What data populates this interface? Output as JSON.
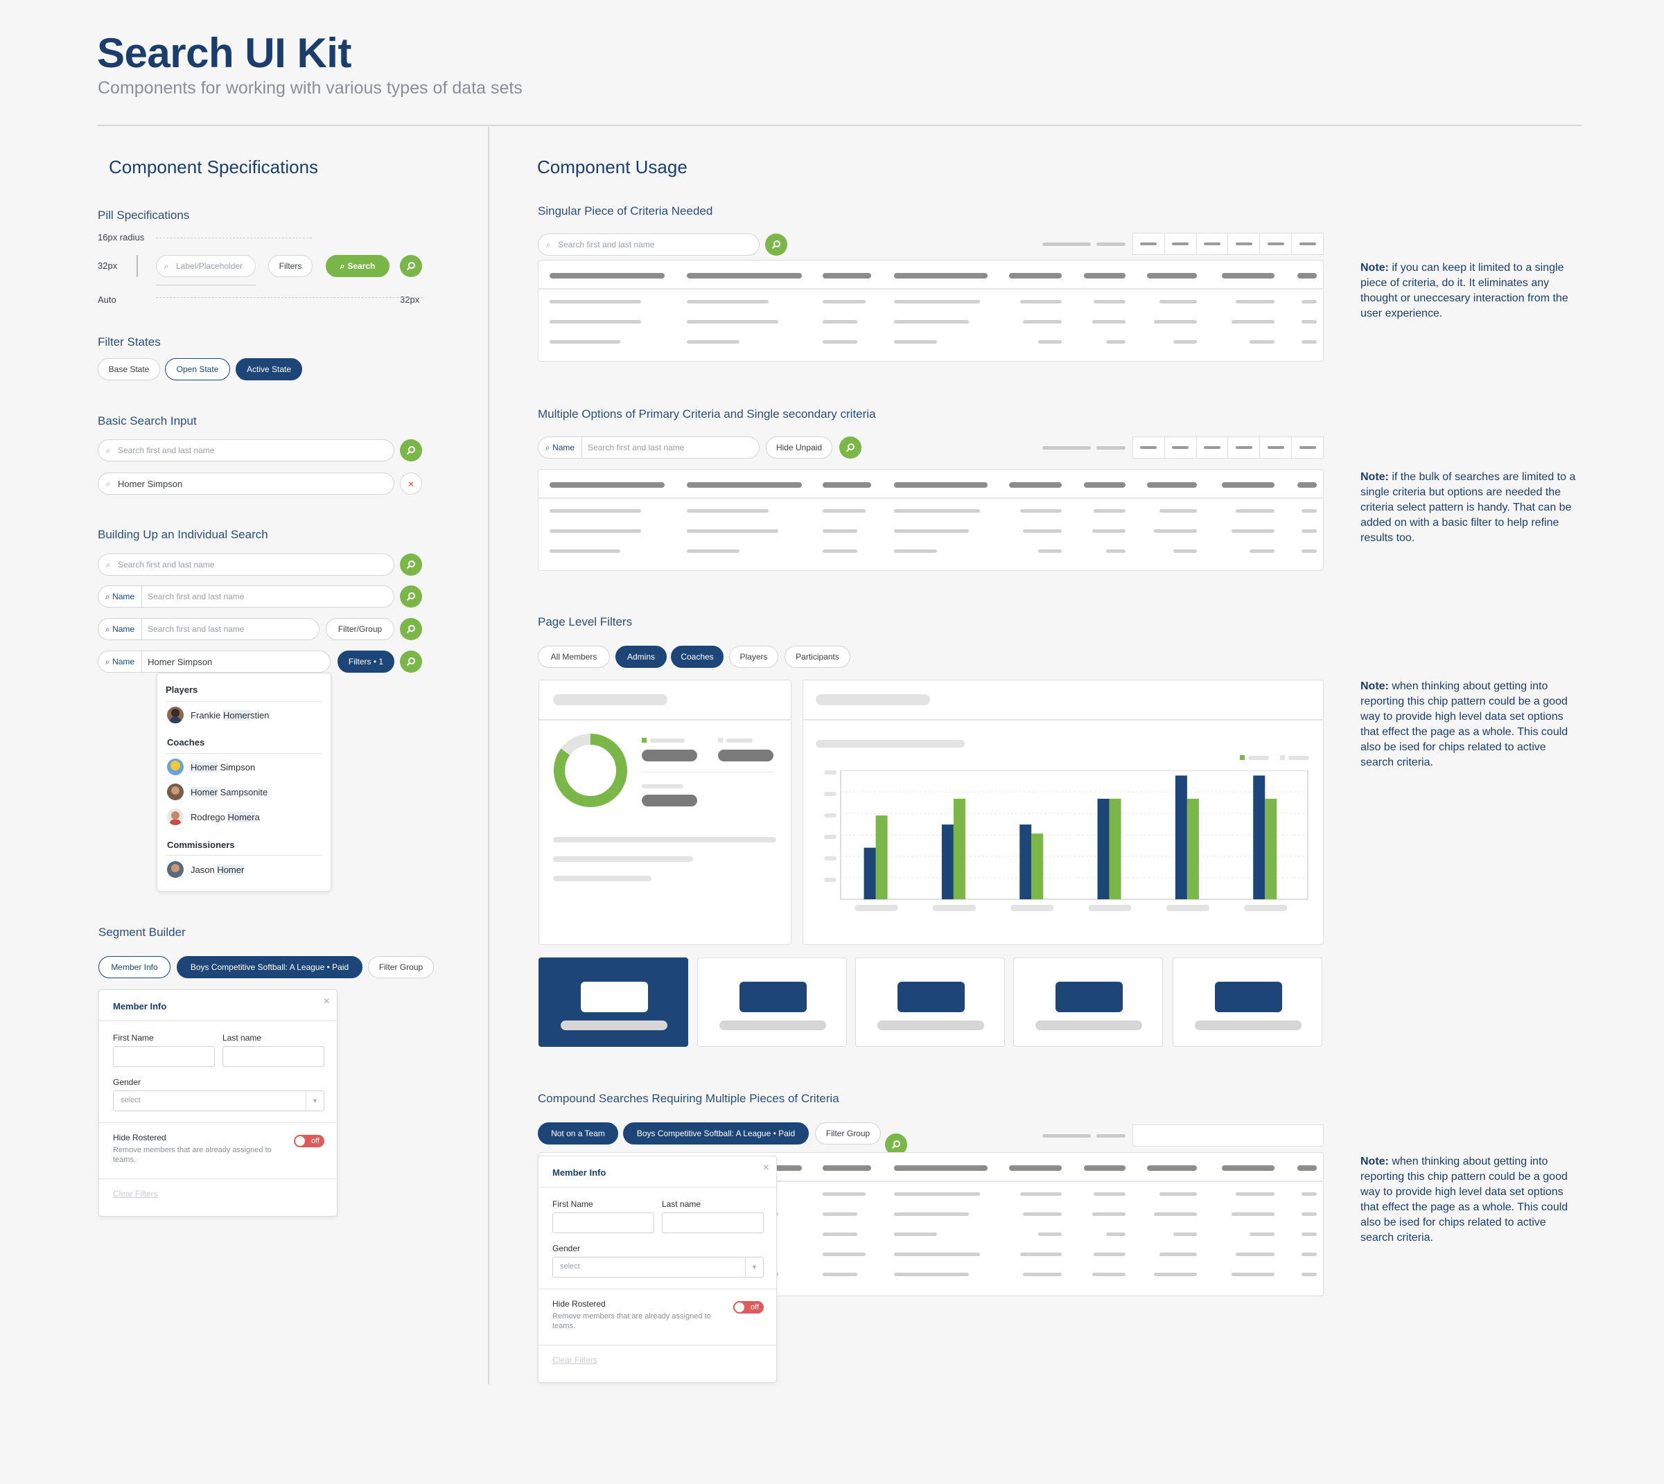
{
  "header": {
    "title": "Search UI Kit",
    "subtitle": "Components for working with various types of data sets"
  },
  "specs": {
    "heading": "Component Specifications",
    "pill_specs": {
      "title": "Pill Specifications",
      "radius_label": "16px radius",
      "height_label": "32px",
      "auto_label": "Auto",
      "width_label": "32px",
      "placeholder": "Label/Placeholder",
      "filters": "Filters",
      "search": "Search"
    },
    "filter_states": {
      "title": "Filter States",
      "base": "Base State",
      "open": "Open State",
      "active": "Active State"
    },
    "basic_search": {
      "title": "Basic Search Input",
      "placeholder": "Search first and last name",
      "value": "Homer Simpson"
    },
    "building": {
      "title": "Building Up an Individual Search",
      "placeholder": "Search first and last name",
      "name_label": "Name",
      "filter_group": "Filter/Group",
      "value": "Homer Simpson",
      "filters_badge": "Filters • 1"
    },
    "dropdown": {
      "players_heading": "Players",
      "player1_pre": "Frankie ",
      "player1_hl": "Homer",
      "player1_post": "stien",
      "coaches_heading": "Coaches",
      "coach1_hl": "Homer",
      "coach1_post": " Simpson",
      "coach2_hl": "Homer",
      "coach2_post": " Sampsonite",
      "coach3_pre": "Rodrego ",
      "coach3_hl": "Homer",
      "coach3_post": "a",
      "commissioners_heading": "Commissioners",
      "comm1_pre": "Jason ",
      "comm1_hl": "Homer"
    },
    "segment": {
      "title": "Segment Builder",
      "member_info": "Member Info",
      "chip": "Boys Competitive Softball: A League • Paid",
      "filter_group": "Filter Group"
    },
    "panel": {
      "title": "Member Info",
      "close": "×",
      "first_name": "First Name",
      "last_name": "Last name",
      "gender": "Gender",
      "select": "select",
      "hide_rostered": "Hide Rostered",
      "hide_desc": "Remove members that are already assigned to teams.",
      "toggle": "off",
      "clear": "Clear Filters"
    }
  },
  "usage": {
    "heading": "Component Usage",
    "singular": {
      "title": "Singular Piece of Criteria Needed",
      "placeholder": "Search first and last name",
      "note_bold": "Note:",
      "note": " if you can keep it limited to a single piece of criteria, do it. It eliminates any thought or uneccesary interaction from the user experience."
    },
    "multiple": {
      "title": "Multiple Options of Primary Criteria and Single secondary criteria",
      "name_label": "Name",
      "placeholder": "Search first and last name",
      "hide_unpaid": "Hide Unpaid",
      "note_bold": "Note:",
      "note": " if the bulk of searches are limited to a single criteria but options are needed the criteria select pattern is handy. That can be added on with a basic filter to help refine results too."
    },
    "page_filters": {
      "title": "Page Level Filters",
      "chips": [
        "All Members",
        "Admins",
        "Coaches",
        "Players",
        "Participants"
      ],
      "note_bold": "Note:",
      "note": " when thinking about getting into reporting this chip pattern could be a good way to provide high level data set options that effect the page as  a whole. This could also be ised for chips related to active search criteria."
    },
    "compound": {
      "title": "Compound Searches Requiring Multiple Pieces of Criteria",
      "chip1": "Not on a Team",
      "chip2": "Boys Competitive Softball: A League • Paid",
      "filter_group": "Filter Group",
      "note_bold": "Note:",
      "note": " when thinking about getting into reporting this chip pattern could be a good way to provide high level data set options that effect the page as  a whole. This could also be ised for chips related to active search criteria."
    }
  },
  "chart_data": {
    "type": "bar",
    "categories": [
      "",
      "",
      "",
      "",
      "",
      ""
    ],
    "series": [
      {
        "values": [
          40,
          58,
          58,
          78,
          96,
          96
        ]
      },
      {
        "values": [
          65,
          78,
          51,
          78,
          78,
          78
        ]
      }
    ],
    "ylim": [
      0,
      100
    ],
    "colors": [
      "#1d4578",
      "#7ab648"
    ]
  },
  "donut": {
    "value_fraction": 0.85,
    "colors": [
      "#7ab648",
      "#e3e3e3"
    ]
  },
  "colors": {
    "brand": "#1b3d6b",
    "accent": "#7ab648",
    "danger": "#e05a5a"
  }
}
